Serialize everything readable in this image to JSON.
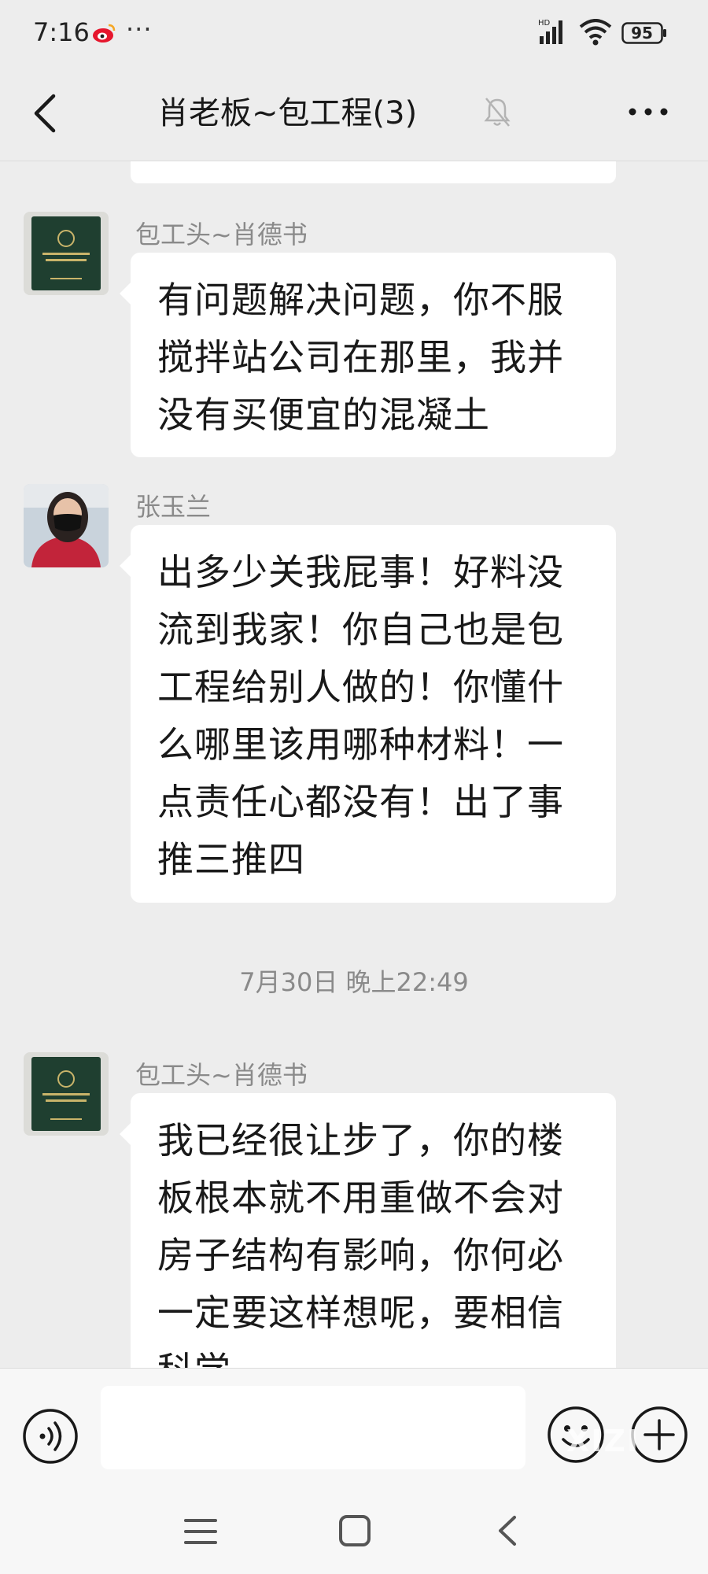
{
  "status_bar": {
    "time": "7:16",
    "dots": "···",
    "network_label": "HD",
    "battery": "95"
  },
  "header": {
    "title": "肖老板~包工程(3)"
  },
  "messages": [
    {
      "sender": "包工头~肖德书",
      "avatar": "certificate-avatar",
      "text": "有问题解决问题，你不服搅拌站公司在那里，我并没有买便宜的混凝土"
    },
    {
      "sender": "张玉兰",
      "avatar": "woman-mask-avatar",
      "text": "出多少关我屁事！好料没流到我家！你自己也是包工程给别人做的！你懂什么哪里该用哪种材料！一点责任心都没有！出了事推三推四"
    },
    {
      "sender": "包工头~肖德书",
      "avatar": "certificate-avatar",
      "text": "我已经很让步了，你的楼板根本就不用重做不会对房子结构有影响，你何必一定要这样想呢，要相信科学"
    }
  ],
  "timestamp": "7月30日 晚上22:49",
  "input": {
    "value": "",
    "watermark": "XIZI"
  },
  "icons": {
    "back": "chevron-left-icon",
    "mute": "bell-muted-icon",
    "more": "more-dots-icon",
    "voice": "voice-icon",
    "emoji": "emoji-icon",
    "plus": "plus-icon"
  },
  "colors": {
    "background": "#ededed",
    "bubble": "#ffffff",
    "meta_text": "#8a8a8a",
    "weibo_red": "#e6162d"
  }
}
